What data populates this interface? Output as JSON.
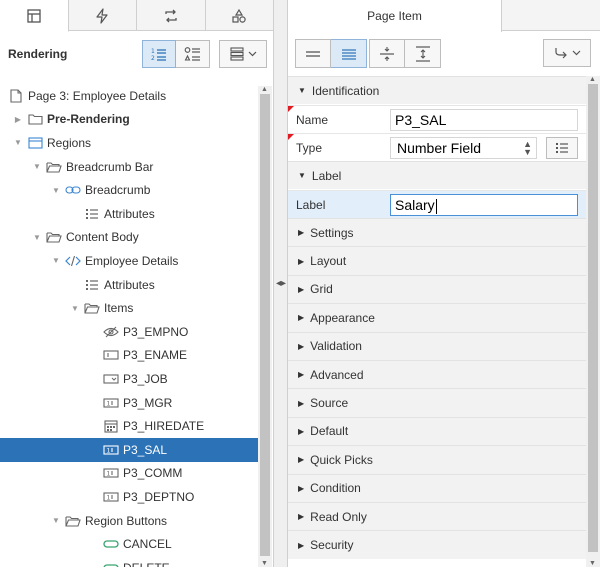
{
  "left_tabs": [
    {
      "icon": "rendering-tree-icon",
      "active": true
    },
    {
      "icon": "lightning-icon",
      "active": false
    },
    {
      "icon": "processing-arrows-icon",
      "active": false
    },
    {
      "icon": "shared-components-icon",
      "active": false
    }
  ],
  "left_header": {
    "title": "Rendering"
  },
  "tree": [
    {
      "label": "Page 3: Employee Details",
      "indent": 0,
      "toggle": "",
      "icon": "page-icon",
      "bold": false,
      "selected": false
    },
    {
      "label": "Pre-Rendering",
      "indent": 1,
      "toggle": "▶",
      "icon": "folder-icon",
      "bold": true,
      "selected": false
    },
    {
      "label": "Regions",
      "indent": 1,
      "toggle": "▼",
      "icon": "region-icon",
      "bold": false,
      "selected": false
    },
    {
      "label": "Breadcrumb Bar",
      "indent": 2,
      "toggle": "▼",
      "icon": "folder-open-icon",
      "bold": false,
      "selected": false
    },
    {
      "label": "Breadcrumb",
      "indent": 3,
      "toggle": "▼",
      "icon": "breadcrumb-icon",
      "bold": false,
      "selected": false
    },
    {
      "label": "Attributes",
      "indent": 4,
      "toggle": "",
      "icon": "attributes-icon",
      "bold": false,
      "selected": false
    },
    {
      "label": "Content Body",
      "indent": 2,
      "toggle": "▼",
      "icon": "folder-open-icon",
      "bold": false,
      "selected": false
    },
    {
      "label": "Employee Details",
      "indent": 3,
      "toggle": "▼",
      "icon": "code-icon",
      "bold": false,
      "selected": false
    },
    {
      "label": "Attributes",
      "indent": 4,
      "toggle": "",
      "icon": "attributes-icon",
      "bold": false,
      "selected": false
    },
    {
      "label": "Items",
      "indent": 4,
      "toggle": "▼",
      "icon": "folder-open-icon",
      "bold": false,
      "selected": false
    },
    {
      "label": "P3_EMPNO",
      "indent": 5,
      "toggle": "",
      "icon": "hidden-item-icon",
      "bold": false,
      "selected": false
    },
    {
      "label": "P3_ENAME",
      "indent": 5,
      "toggle": "",
      "icon": "text-field-icon",
      "bold": false,
      "selected": false
    },
    {
      "label": "P3_JOB",
      "indent": 5,
      "toggle": "",
      "icon": "select-list-icon",
      "bold": false,
      "selected": false
    },
    {
      "label": "P3_MGR",
      "indent": 5,
      "toggle": "",
      "icon": "number-field-icon",
      "bold": false,
      "selected": false
    },
    {
      "label": "P3_HIREDATE",
      "indent": 5,
      "toggle": "",
      "icon": "date-picker-icon",
      "bold": false,
      "selected": false
    },
    {
      "label": "P3_SAL",
      "indent": 5,
      "toggle": "",
      "icon": "number-field-icon",
      "bold": false,
      "selected": true
    },
    {
      "label": "P3_COMM",
      "indent": 5,
      "toggle": "",
      "icon": "number-field-icon",
      "bold": false,
      "selected": false
    },
    {
      "label": "P3_DEPTNO",
      "indent": 5,
      "toggle": "",
      "icon": "number-field-icon",
      "bold": false,
      "selected": false
    },
    {
      "label": "Region Buttons",
      "indent": 3,
      "toggle": "▼",
      "icon": "folder-open-icon",
      "bold": false,
      "selected": false
    },
    {
      "label": "CANCEL",
      "indent": 5,
      "toggle": "",
      "icon": "button-icon",
      "bold": false,
      "selected": false
    },
    {
      "label": "DELETE",
      "indent": 5,
      "toggle": "",
      "icon": "button-icon",
      "bold": false,
      "selected": false
    }
  ],
  "right_tab": {
    "label": "Page Item"
  },
  "identification": {
    "label": "Identification"
  },
  "name_row": {
    "label": "Name",
    "value": "P3_SAL"
  },
  "type_row": {
    "label": "Type",
    "value": "Number Field"
  },
  "label_section": {
    "label": "Label"
  },
  "label_row": {
    "label": "Label",
    "value": "Salary"
  },
  "sections": [
    "Settings",
    "Layout",
    "Grid",
    "Appearance",
    "Validation",
    "Advanced",
    "Source",
    "Default",
    "Quick Picks",
    "Condition",
    "Read Only",
    "Security"
  ],
  "colors": {
    "selection": "#2c72b7",
    "required_marker": "#e21b23",
    "focus_row": "#e2eef9"
  }
}
